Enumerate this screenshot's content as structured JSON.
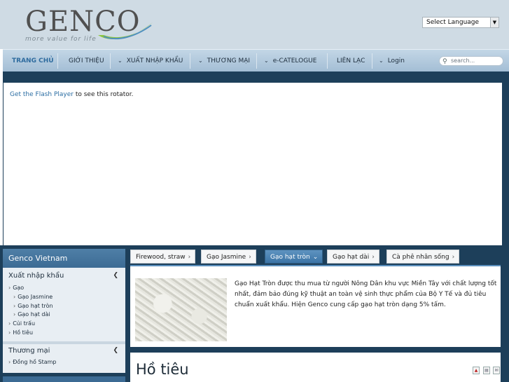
{
  "header": {
    "logo_text": "GENCO",
    "logo_tagline": "more value for life",
    "language_select": "Select Language"
  },
  "nav": {
    "items": [
      {
        "label": "TRANG CHỦ",
        "active": true,
        "has_dropdown": false
      },
      {
        "label": "GIỚI THIỆU",
        "active": false,
        "has_dropdown": false
      },
      {
        "label": "XUẤT NHẬP KHẨU",
        "active": false,
        "has_dropdown": true
      },
      {
        "label": "THƯƠNG MẠI",
        "active": false,
        "has_dropdown": true
      },
      {
        "label": "e-CATELOGUE",
        "active": false,
        "has_dropdown": true
      },
      {
        "label": "LIÊN LẠC",
        "active": false,
        "has_dropdown": false
      },
      {
        "label": "Login",
        "active": false,
        "has_dropdown": true
      }
    ],
    "search_placeholder": "search..."
  },
  "flash": {
    "link": "Get the Flash Player",
    "rest": " to see this rotator."
  },
  "sidebar": {
    "title": "Genco Vietnam",
    "groups": [
      {
        "label": "Xuất nhập khẩu",
        "items": [
          {
            "label": "Gạo",
            "level": 1
          },
          {
            "label": "Gạo Jasmine",
            "level": 2
          },
          {
            "label": "Gạo hạt tròn",
            "level": 2
          },
          {
            "label": "Gạo hạt dài",
            "level": 2
          },
          {
            "label": "Củi trấu",
            "level": 1
          },
          {
            "label": "Hồ tiêu",
            "level": 1
          }
        ]
      },
      {
        "label": "Thương mại",
        "items": [
          {
            "label": "Đồng hồ Stamp",
            "level": 1
          }
        ]
      }
    ]
  },
  "tabs": [
    {
      "label": "Firewood, straw",
      "active": false
    },
    {
      "label": "Gạo Jasmine",
      "active": false
    },
    {
      "label": "Gạo hạt tròn",
      "active": true
    },
    {
      "label": "Gạo hạt dài",
      "active": false
    },
    {
      "label": "Cà phê nhân sống",
      "active": false
    }
  ],
  "content": {
    "description": "Gạo Hạt Tròn được thu mua từ người Nông Dân khu vực Miền Tây với chất lượng tốt nhất, đảm bảo đúng kỹ thuật an toàn vệ sinh thực phẩm của Bộ Y Tế và đủ tiêu chuẩn xuất khẩu. Hiện Genco cung cấp gạo hạt tròn dạng 5% tấm."
  },
  "panel2": {
    "title": "Hồ tiêu",
    "tools": [
      "pdf-icon",
      "print-icon",
      "email-icon"
    ]
  }
}
